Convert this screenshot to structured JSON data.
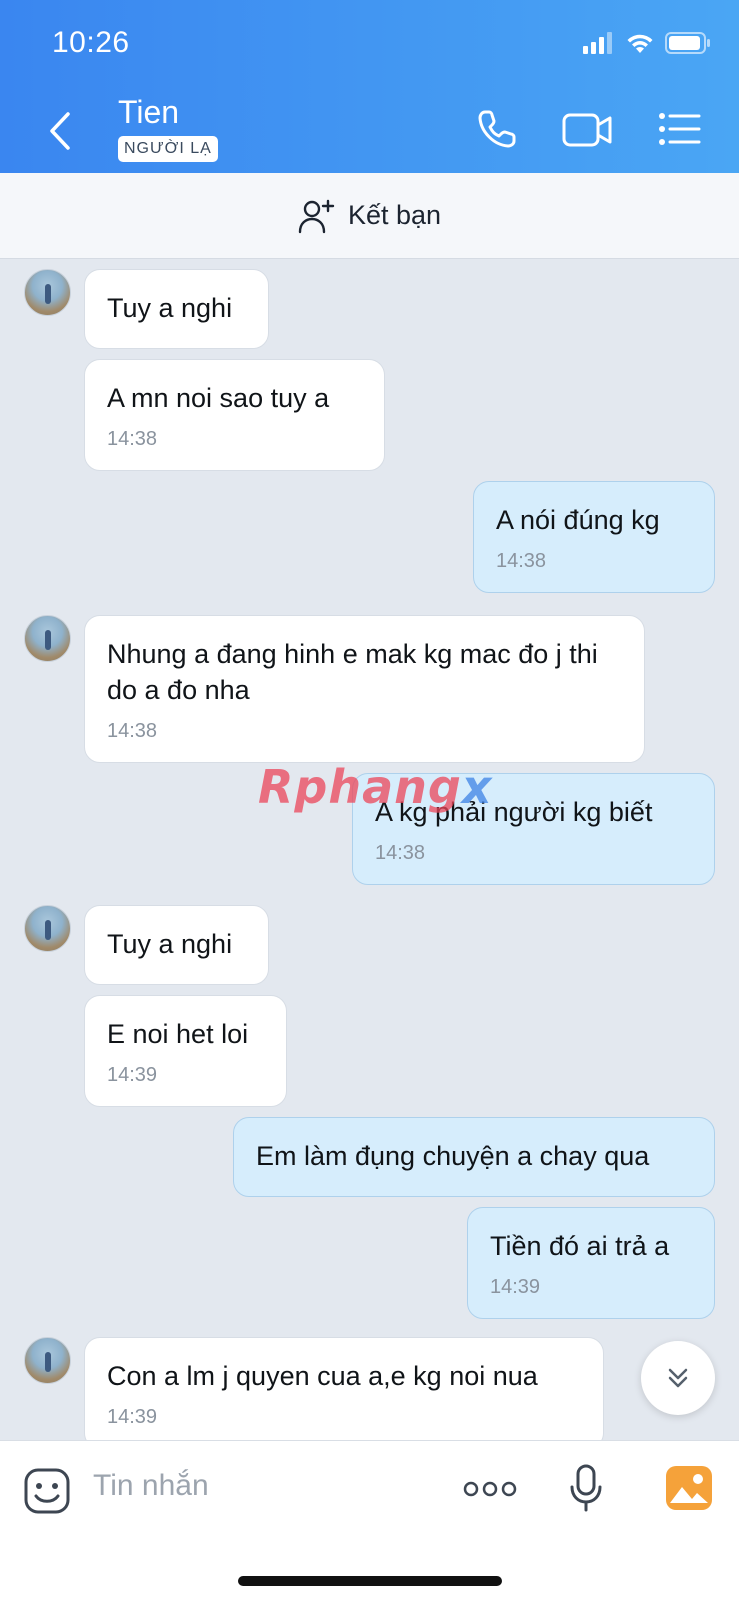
{
  "status_bar": {
    "time": "10:26"
  },
  "header": {
    "contact_name": "Tien",
    "badge": "NGƯỜI LẠ",
    "gradient_start": "#3a86f0",
    "gradient_end": "#4aa6f4"
  },
  "add_friend": {
    "label": "Kết bạn"
  },
  "messages": [
    {
      "dir": "in",
      "text": "Tuy a nghi",
      "time": ""
    },
    {
      "dir": "in",
      "text": "A mn noi sao tuy a",
      "time": "14:38"
    },
    {
      "dir": "out",
      "text": "A nói đúng kg",
      "time": "14:38"
    },
    {
      "dir": "in",
      "text": "Nhung a đang hinh e mak kg mac đo j thi do a đo nha",
      "time": "14:38"
    },
    {
      "dir": "out",
      "text": "A kg phải người kg biết",
      "time": "14:38"
    },
    {
      "dir": "in",
      "text": "Tuy a nghi",
      "time": ""
    },
    {
      "dir": "in",
      "text": "E noi het loi",
      "time": "14:39"
    },
    {
      "dir": "out",
      "text": "Em làm đụng chuyện a chay qua",
      "time": ""
    },
    {
      "dir": "out",
      "text": "Tiền đó ai trả a",
      "time": "14:39"
    },
    {
      "dir": "in",
      "text": "Con a lm j quyen cua a,e kg noi nua",
      "time": "14:39"
    }
  ],
  "watermark": {
    "part1": "Rphang",
    "part2": "x"
  },
  "input": {
    "placeholder": "Tin nhắn"
  },
  "colors": {
    "bubble_in": "#ffffff",
    "bubble_out": "#d6edfc",
    "chat_bg": "#e3e8ef"
  }
}
